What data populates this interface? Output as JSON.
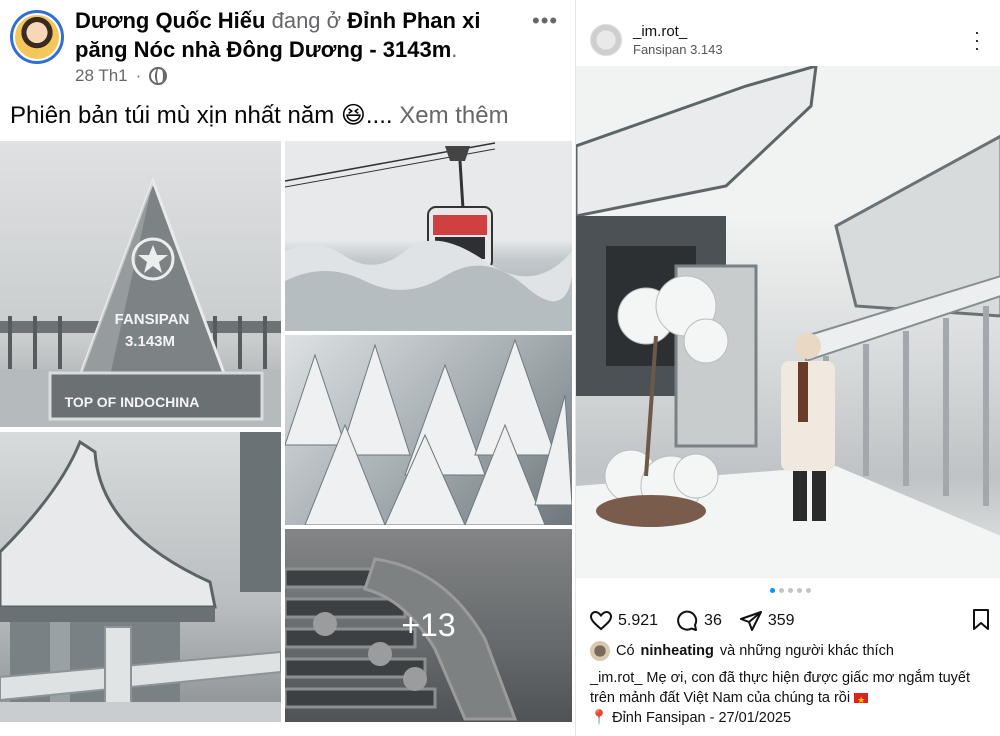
{
  "facebook": {
    "author": "Dương Quốc Hiếu",
    "location_prefix": "đang ở",
    "location": "Đỉnh Phan xi păng Nóc nhà Đông Dương - 3143m",
    "location_suffix": ".",
    "date": "28 Th1",
    "caption": "Phiên bản túi mù xịn nhất năm 😆....",
    "see_more": "Xem thêm",
    "photo_texts": {
      "sign_top": "FANSIPAN",
      "sign_height": "3.143M",
      "sign_base": "TOP OF INDOCHINA"
    },
    "more_photos": "+13",
    "colors": {
      "avatar_ring": "#2f6fd6",
      "muted": "#65676b"
    }
  },
  "instagram": {
    "username": "_im.rot_",
    "location": "Fansipan 3.143",
    "likes": "5.921",
    "comments": "36",
    "shares": "359",
    "liked_by_prefix": "Có",
    "liked_by_user": "ninheating",
    "liked_by_suffix": "và những người khác thích",
    "caption_user": "_im.rot_",
    "caption_text": "Mẹ ơi, con đã thực hiện được giấc mơ ngắm tuyết trên mảnh đất Việt Nam của chúng ta rồi",
    "caption_place": "Đỉnh Fansipan - 27/01/2025",
    "carousel_total": 5,
    "carousel_active": 1,
    "colors": {
      "carousel_active": "#0095f6"
    }
  }
}
